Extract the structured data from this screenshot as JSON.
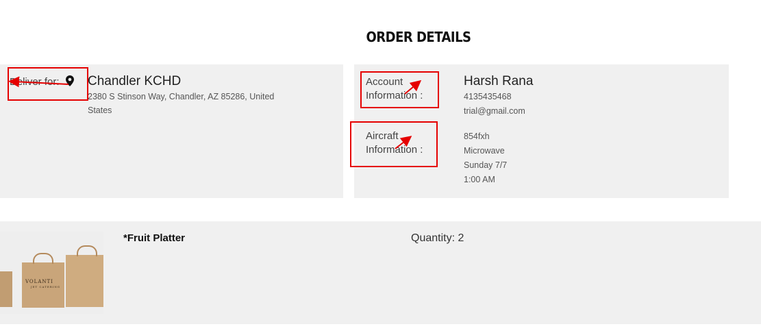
{
  "page": {
    "title": "ORDER DETAILS"
  },
  "deliver": {
    "label": "Deliver for:",
    "location_name": "Chandler KCHD",
    "address_line1": "2380 S Stinson Way, Chandler, AZ 85286, United",
    "address_line2": "States",
    "icon": "map-pin-icon"
  },
  "account": {
    "label_line1": "Account",
    "label_line2": "Information :",
    "name": "Harsh Rana",
    "phone": "4135435468",
    "email": "trial@gmail.com"
  },
  "aircraft": {
    "label_line1": "Aircraft",
    "label_line2": "Information :",
    "tail": "854fxh",
    "equipment": "Microwave",
    "day": "Sunday 7/7",
    "time": "1:00 AM"
  },
  "item": {
    "name": "*Fruit Platter",
    "quantity": "Quantity: 2",
    "image_brand": "VOLANTI",
    "image_brand_sub": "JET CATERING"
  },
  "colors": {
    "annotation": "#e50000",
    "panel_bg": "#f0f0f0"
  }
}
